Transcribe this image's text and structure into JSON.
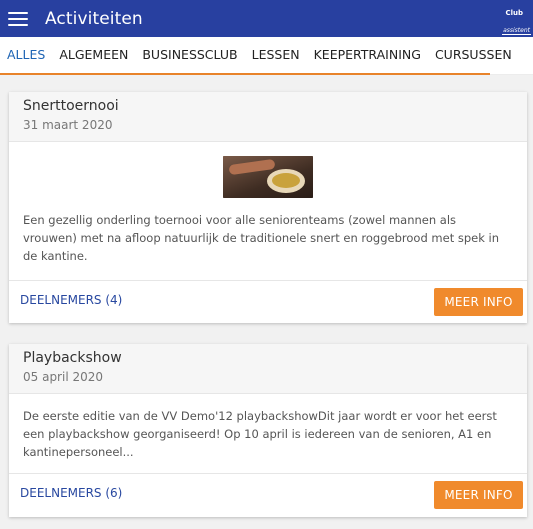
{
  "appbar": {
    "title": "Activiteiten",
    "menu_icon": "hamburger-menu-icon",
    "logo_line1": "Club",
    "logo_line2": "assistent"
  },
  "tabs": [
    {
      "label": "ALLES",
      "active": true
    },
    {
      "label": "ALGEMEEN",
      "active": false
    },
    {
      "label": "BUSINESSCLUB",
      "active": false
    },
    {
      "label": "LESSEN",
      "active": false
    },
    {
      "label": "KEEPERTRAINING",
      "active": false
    },
    {
      "label": "CURSUSSEN",
      "active": false
    }
  ],
  "colors": {
    "appbar": "#2840a0",
    "accent": "#e8832a",
    "button": "#f08a2c",
    "link": "#2848a0"
  },
  "events": [
    {
      "title": "Snerttoernooi",
      "date": "31 maart 2020",
      "has_image": true,
      "description": "Een gezellig onderling toernooi voor alle seniorenteams (zowel mannen als vrouwen) met na afloop natuurlijk de traditionele snert en roggebrood met spek in de kantine.",
      "participants_link": "DEELNEMERS (4)",
      "button_label": "MEER INFO"
    },
    {
      "title": "Playbackshow",
      "date": "05 april 2020",
      "has_image": false,
      "description": "De eerste editie van de VV Demo'12 playbackshowDit jaar wordt er voor het eerst een playbackshow georganiseerd! Op 10 april is iedereen van de senioren, A1 en kantinepersoneel...",
      "participants_link": "DEELNEMERS (6)",
      "button_label": "MEER INFO"
    }
  ]
}
